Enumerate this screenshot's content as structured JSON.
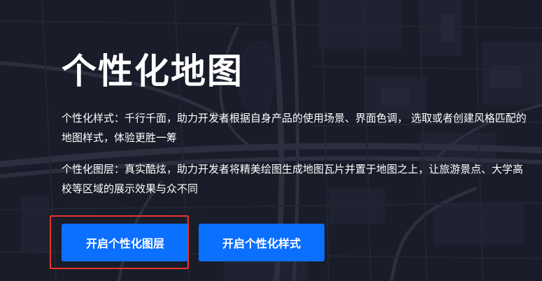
{
  "hero": {
    "title": "个性化地图",
    "desc_style": "个性化样式：千行千面，助力开发者根据自身产品的使用场景、界面色调， 选取或者创建风格匹配的地图样式，体验更胜一筹",
    "desc_layer": "个性化图层：真实酷炫，助力开发者将精美绘图生成地图瓦片并置于地图之上，让旅游景点、大学高校等区域的展示效果与众不同"
  },
  "buttons": {
    "layer_label": "开启个性化图层",
    "style_label": "开启个性化样式"
  },
  "colors": {
    "background": "#1c1f2b",
    "road": "#3a3e4c",
    "block": "#2b2f3c",
    "accent": "#0b6fff",
    "highlight": "#e8352b"
  }
}
